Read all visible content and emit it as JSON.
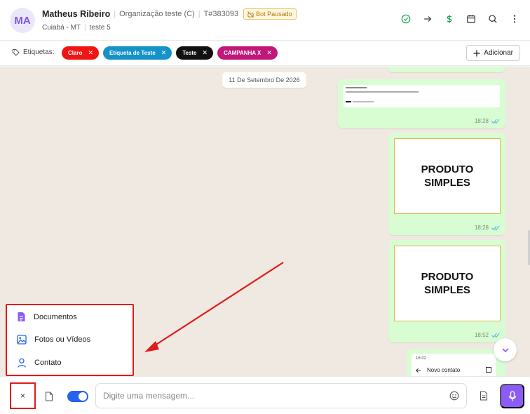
{
  "header": {
    "avatar_initials": "MA",
    "contact_name": "Matheus Ribeiro",
    "organization": "Organização teste (C)",
    "ticket_id": "T#383093",
    "bot_status": "Bot Pausado",
    "location": "Cuiabá - MT",
    "queue": "teste 5",
    "icons": [
      "check-circle-icon",
      "arrow-right-icon",
      "dollar-icon",
      "calendar-icon",
      "search-icon",
      "more-vertical-icon"
    ]
  },
  "tags": {
    "label": "Etiquetas:",
    "items": [
      {
        "label": "Claro",
        "color": "#f01414"
      },
      {
        "label": "Etiqueta de Teste",
        "color": "#1592c7"
      },
      {
        "label": "Teste",
        "color": "#111111"
      },
      {
        "label": "CAMPANHA X",
        "color": "#c2167a"
      }
    ],
    "add_label": "Adicionar"
  },
  "chat": {
    "date_label": "11 De Setembro De 2026",
    "messages": [
      {
        "type": "document",
        "time": "18:28"
      },
      {
        "type": "image",
        "caption_line1": "PRODUTO",
        "caption_line2": "SIMPLES",
        "time": "18:28"
      },
      {
        "type": "image",
        "caption_line1": "PRODUTO",
        "caption_line2": "SIMPLES",
        "time": "18:52"
      },
      {
        "type": "image",
        "screen_time": "16:02",
        "screen_title": "Novo contato"
      }
    ]
  },
  "attach_menu": {
    "items": [
      {
        "label": "Documentos",
        "icon": "document-icon",
        "color": "#8b5cf6"
      },
      {
        "label": "Fotos ou Vídeos",
        "icon": "image-icon",
        "color": "#2563eb"
      },
      {
        "label": "Contato",
        "icon": "user-icon",
        "color": "#2563eb"
      }
    ]
  },
  "composer": {
    "close_symbol": "×",
    "placeholder": "Digite uma mensagem...",
    "accent_color": "#8b5cf6"
  }
}
